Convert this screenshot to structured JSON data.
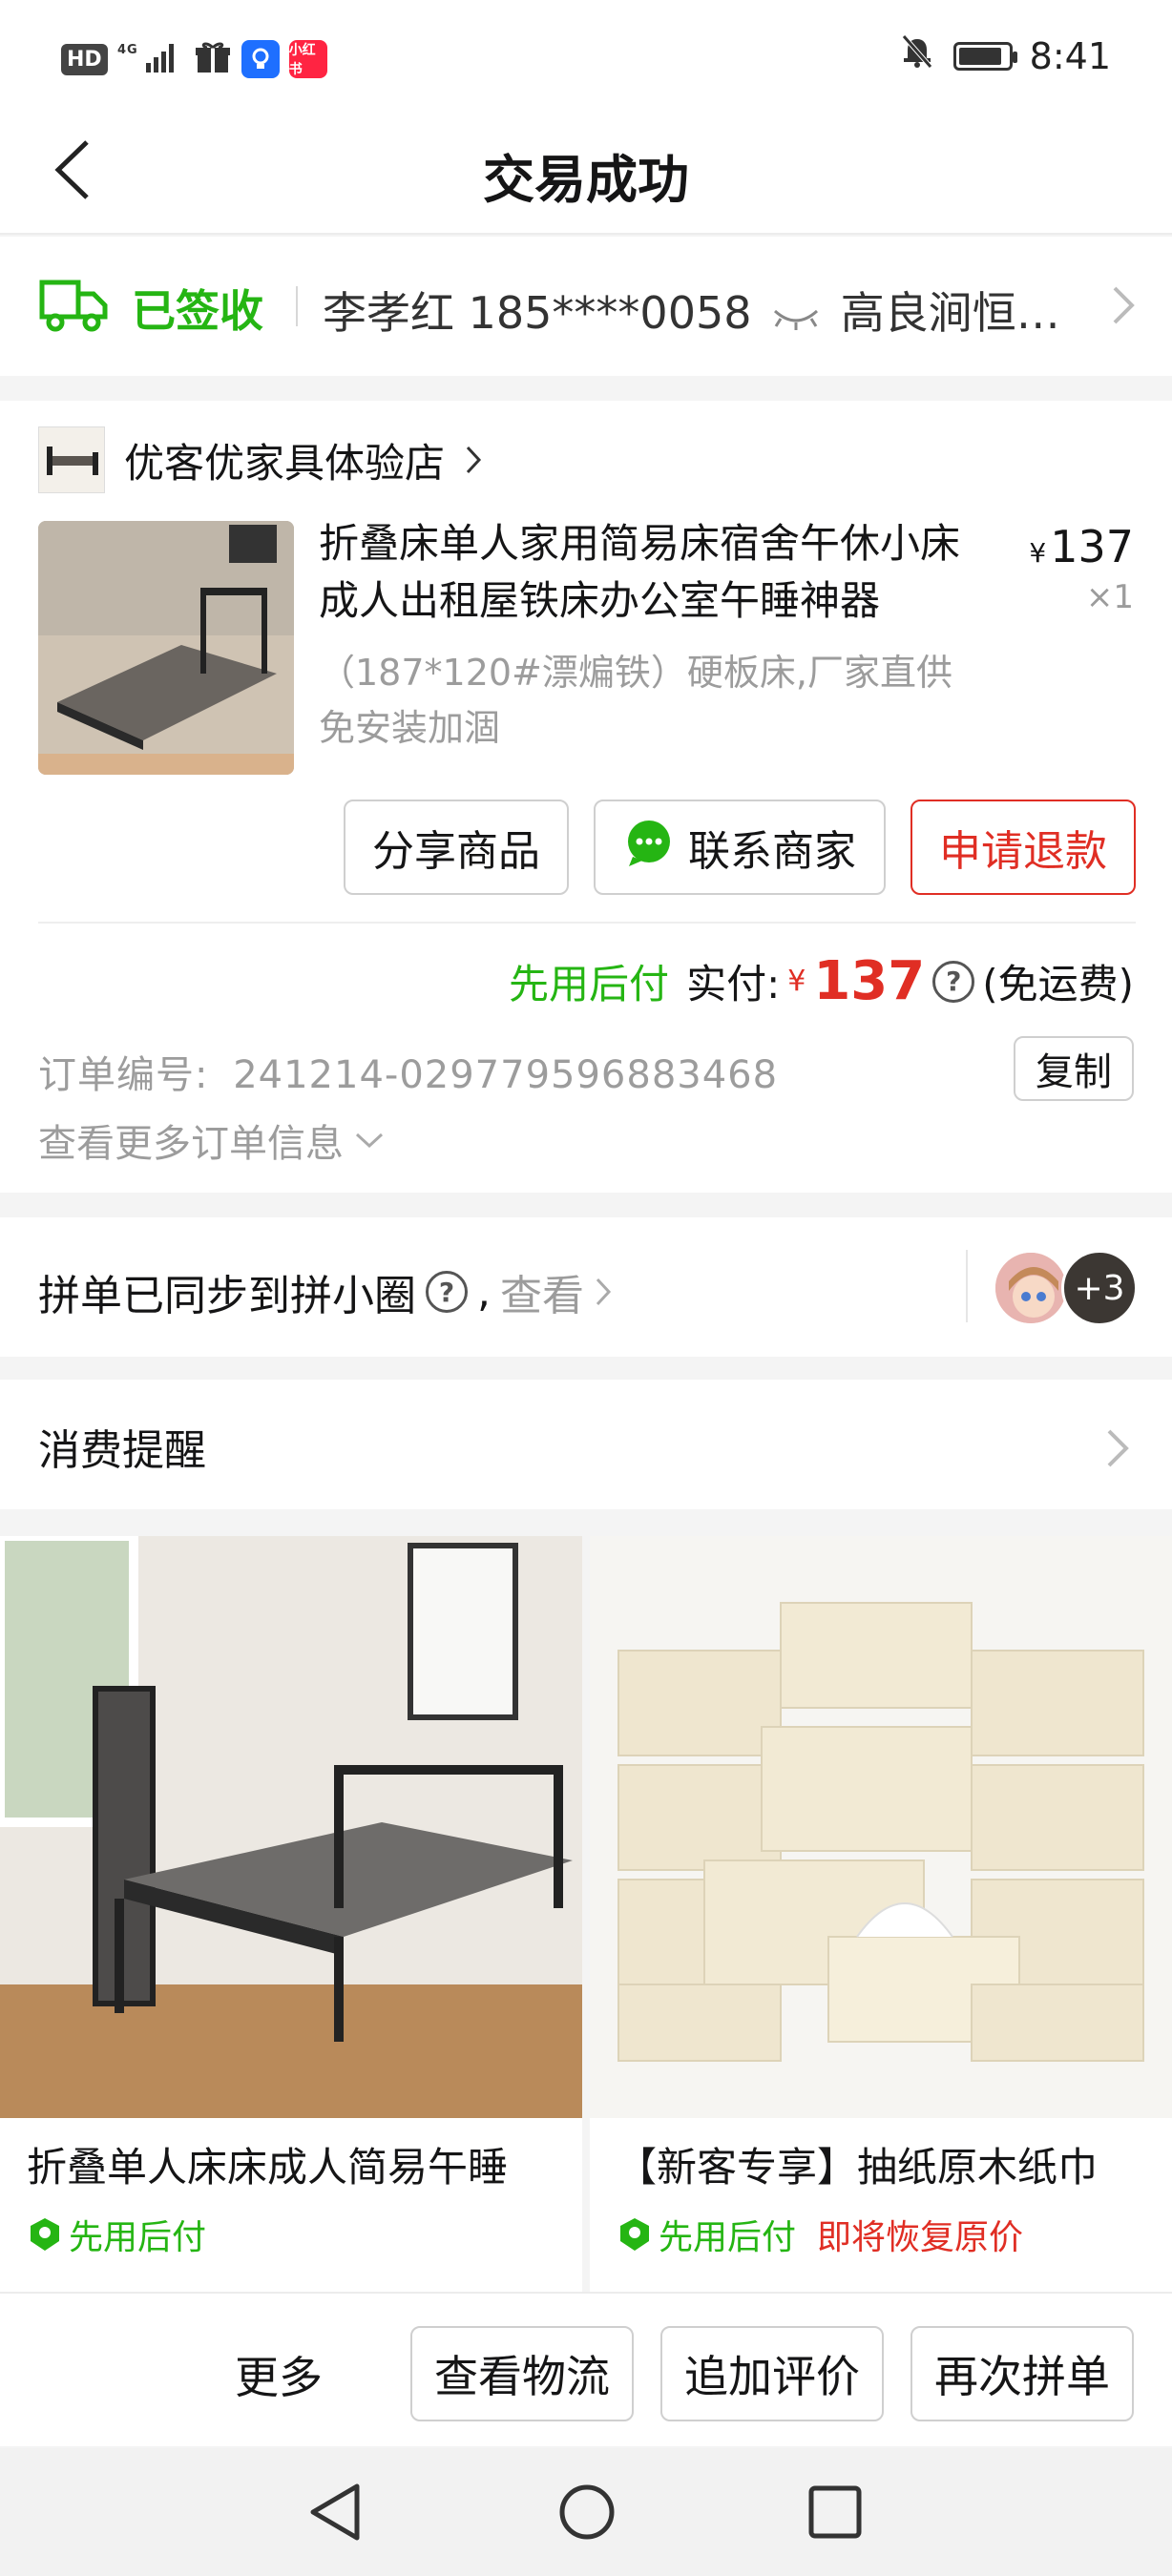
{
  "status_bar": {
    "hd": "HD",
    "signal": "4G",
    "app_red_label": "小红书",
    "time": "8:41"
  },
  "header": {
    "title": "交易成功"
  },
  "logistics": {
    "status": "已签收",
    "recipient": "李孝红 185****0058",
    "address": "高良涧恒…"
  },
  "order": {
    "shop_name": "优客优家具体验店",
    "product_title": "折叠床单人家用简易床宿舍午休小床成人出租屋铁床办公室午睡神器",
    "sku": "（187*120#漂煸铁）硬板床,厂家直供免安装加涸",
    "price_currency": "¥",
    "price": "137",
    "quantity": "×1",
    "buttons": {
      "share": "分享商品",
      "contact": "联系商家",
      "refund": "申请退款"
    },
    "pay_later": "先用后付",
    "paid_label": "实付:",
    "paid_currency": "¥",
    "paid_amount": "137",
    "shipping": "(免运费)",
    "order_no_label": "订单编号:",
    "order_no": "241214-029779596883468",
    "copy": "复制",
    "more_info": "查看更多订单信息"
  },
  "group": {
    "synced_text": "拼单已同步到拼小圈",
    "comma": ",",
    "view": "查看",
    "extra_count": "+3"
  },
  "reminder": {
    "label": "消费提醒"
  },
  "recommendations": [
    {
      "title": "折叠单人床床成人简易午睡",
      "tag": "先用后付",
      "tag2": ""
    },
    {
      "title": "【新客专享】抽纸原木纸巾",
      "tag": "先用后付",
      "tag2": "即将恢复原价"
    }
  ],
  "bottom_bar": {
    "more": "更多",
    "logistics": "查看物流",
    "review": "追加评价",
    "reorder": "再次拼单"
  },
  "colors": {
    "green": "#25b513",
    "red": "#e02e24",
    "text": "#151516",
    "muted": "#9c9c9c"
  }
}
